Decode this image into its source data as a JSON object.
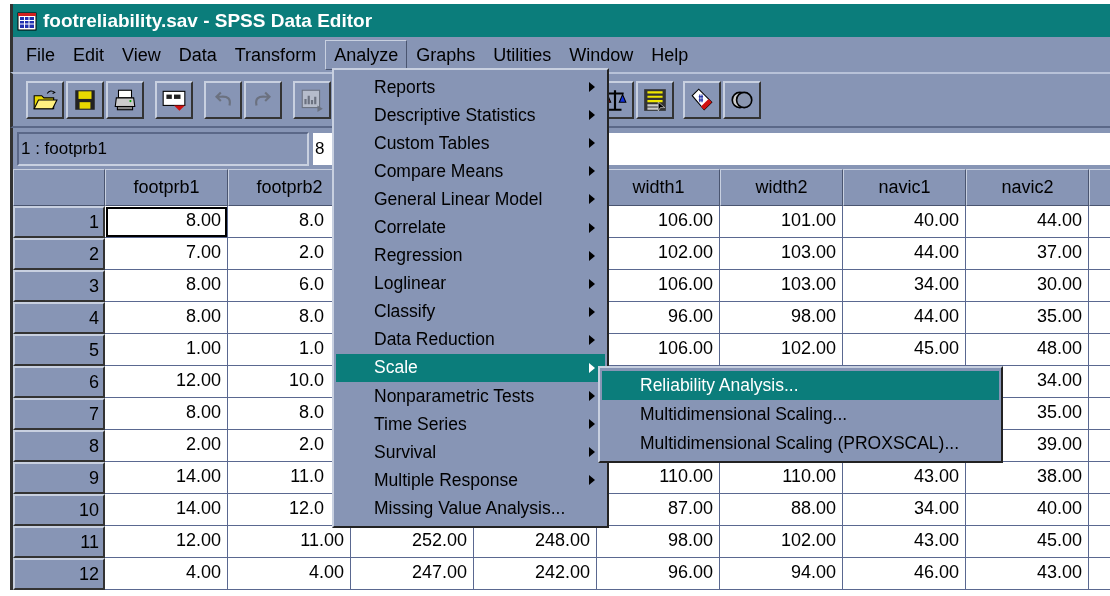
{
  "window": {
    "title": "footreliability.sav - SPSS Data Editor"
  },
  "menu_bar": [
    {
      "label": "File",
      "selected": false
    },
    {
      "label": "Edit",
      "selected": false
    },
    {
      "label": "View",
      "selected": false
    },
    {
      "label": "Data",
      "selected": false
    },
    {
      "label": "Transform",
      "selected": false
    },
    {
      "label": "Analyze",
      "selected": true
    },
    {
      "label": "Graphs",
      "selected": false
    },
    {
      "label": "Utilities",
      "selected": false
    },
    {
      "label": "Window",
      "selected": false
    },
    {
      "label": "Help",
      "selected": false
    }
  ],
  "toolbar": {
    "left": [
      {
        "kind": "open",
        "disabled": false
      },
      {
        "kind": "save",
        "disabled": false
      },
      {
        "kind": "print",
        "disabled": false
      },
      {
        "kind": "dialog",
        "disabled": false
      },
      {
        "kind": "undo",
        "disabled": true
      },
      {
        "kind": "redo",
        "disabled": true
      },
      {
        "kind": "chart",
        "disabled": true
      }
    ],
    "right": [
      {
        "kind": "scales",
        "disabled": false
      },
      {
        "kind": "table",
        "disabled": false
      },
      {
        "kind": "tag",
        "disabled": false
      },
      {
        "kind": "circles",
        "disabled": false
      }
    ]
  },
  "cell_editor": {
    "cell": "1 : footprb1",
    "value": "8"
  },
  "table": {
    "columns": [
      "footprb1",
      "footprb2",
      null,
      null,
      "width1",
      "width2",
      "navic1",
      "navic2"
    ],
    "rows": [
      {
        "label": "1",
        "cells": [
          {
            "value": "8.00",
            "selected": true
          },
          {
            "value": "8.0",
            "selected": false
          },
          null,
          null,
          {
            "value": "106.00",
            "selected": false
          },
          {
            "value": "101.00",
            "selected": false
          },
          {
            "value": "40.00",
            "selected": false
          },
          {
            "value": "44.00",
            "selected": false
          }
        ]
      },
      {
        "label": "2",
        "cells": [
          {
            "value": "7.00",
            "selected": false
          },
          {
            "value": "2.0",
            "selected": false
          },
          null,
          null,
          {
            "value": "102.00",
            "selected": false
          },
          {
            "value": "103.00",
            "selected": false
          },
          {
            "value": "44.00",
            "selected": false
          },
          {
            "value": "37.00",
            "selected": false
          }
        ]
      },
      {
        "label": "3",
        "cells": [
          {
            "value": "8.00",
            "selected": false
          },
          {
            "value": "6.0",
            "selected": false
          },
          null,
          null,
          {
            "value": "106.00",
            "selected": false
          },
          {
            "value": "103.00",
            "selected": false
          },
          {
            "value": "34.00",
            "selected": false
          },
          {
            "value": "30.00",
            "selected": false
          }
        ]
      },
      {
        "label": "4",
        "cells": [
          {
            "value": "8.00",
            "selected": false
          },
          {
            "value": "8.0",
            "selected": false
          },
          null,
          null,
          {
            "value": "96.00",
            "selected": false
          },
          {
            "value": "98.00",
            "selected": false
          },
          {
            "value": "44.00",
            "selected": false
          },
          {
            "value": "35.00",
            "selected": false
          }
        ]
      },
      {
        "label": "5",
        "cells": [
          {
            "value": "1.00",
            "selected": false
          },
          {
            "value": "1.0",
            "selected": false
          },
          null,
          null,
          {
            "value": "106.00",
            "selected": false
          },
          {
            "value": "102.00",
            "selected": false
          },
          {
            "value": "45.00",
            "selected": false
          },
          {
            "value": "48.00",
            "selected": false
          }
        ]
      },
      {
        "label": "6",
        "cells": [
          {
            "value": "12.00",
            "selected": false
          },
          {
            "value": "10.0",
            "selected": false
          },
          null,
          null,
          null,
          null,
          null,
          {
            "value": "34.00",
            "selected": false
          }
        ]
      },
      {
        "label": "7",
        "cells": [
          {
            "value": "8.00",
            "selected": false
          },
          {
            "value": "8.0",
            "selected": false
          },
          null,
          null,
          null,
          null,
          null,
          {
            "value": "35.00",
            "selected": false
          }
        ]
      },
      {
        "label": "8",
        "cells": [
          {
            "value": "2.00",
            "selected": false
          },
          {
            "value": "2.0",
            "selected": false
          },
          null,
          null,
          null,
          null,
          null,
          {
            "value": "39.00",
            "selected": false
          }
        ]
      },
      {
        "label": "9",
        "cells": [
          {
            "value": "14.00",
            "selected": false
          },
          {
            "value": "11.0",
            "selected": false
          },
          null,
          null,
          {
            "value": "110.00",
            "selected": false
          },
          {
            "value": "110.00",
            "selected": false
          },
          {
            "value": "43.00",
            "selected": false
          },
          {
            "value": "38.00",
            "selected": false
          }
        ]
      },
      {
        "label": "10",
        "cells": [
          {
            "value": "14.00",
            "selected": false
          },
          {
            "value": "12.0",
            "selected": false
          },
          null,
          null,
          {
            "value": "87.00",
            "selected": false
          },
          {
            "value": "88.00",
            "selected": false
          },
          {
            "value": "34.00",
            "selected": false
          },
          {
            "value": "40.00",
            "selected": false
          }
        ]
      },
      {
        "label": "11",
        "cells": [
          {
            "value": "12.00",
            "selected": false
          },
          {
            "value": "11.00",
            "selected": false
          },
          {
            "value": "252.00",
            "selected": false
          },
          {
            "value": "248.00",
            "selected": false
          },
          {
            "value": "98.00",
            "selected": false
          },
          {
            "value": "102.00",
            "selected": false
          },
          {
            "value": "43.00",
            "selected": false
          },
          {
            "value": "45.00",
            "selected": false
          }
        ]
      },
      {
        "label": "12",
        "cells": [
          {
            "value": "4.00",
            "selected": false
          },
          {
            "value": "4.00",
            "selected": false
          },
          {
            "value": "247.00",
            "selected": false
          },
          {
            "value": "242.00",
            "selected": false
          },
          {
            "value": "96.00",
            "selected": false
          },
          {
            "value": "94.00",
            "selected": false
          },
          {
            "value": "46.00",
            "selected": false
          },
          {
            "value": "43.00",
            "selected": false
          }
        ]
      }
    ]
  },
  "analyze_menu": [
    {
      "label": "Reports",
      "submenu": true,
      "selected": false
    },
    {
      "label": "Descriptive Statistics",
      "submenu": true,
      "selected": false
    },
    {
      "label": "Custom Tables",
      "submenu": true,
      "selected": false
    },
    {
      "label": "Compare Means",
      "submenu": true,
      "selected": false
    },
    {
      "label": "General Linear Model",
      "submenu": true,
      "selected": false
    },
    {
      "label": "Correlate",
      "submenu": true,
      "selected": false
    },
    {
      "label": "Regression",
      "submenu": true,
      "selected": false
    },
    {
      "label": "Loglinear",
      "submenu": true,
      "selected": false
    },
    {
      "label": "Classify",
      "submenu": true,
      "selected": false
    },
    {
      "label": "Data Reduction",
      "submenu": true,
      "selected": false
    },
    {
      "label": "Scale",
      "submenu": true,
      "selected": true
    },
    {
      "label": "Nonparametric Tests",
      "submenu": true,
      "selected": false
    },
    {
      "label": "Time Series",
      "submenu": true,
      "selected": false
    },
    {
      "label": "Survival",
      "submenu": true,
      "selected": false
    },
    {
      "label": "Multiple Response",
      "submenu": true,
      "selected": false
    },
    {
      "label": "Missing Value Analysis...",
      "submenu": false,
      "selected": false
    }
  ],
  "scale_submenu": [
    {
      "label": "Reliability Analysis...",
      "selected": true
    },
    {
      "label": "Multidimensional Scaling...",
      "selected": false
    },
    {
      "label": "Multidimensional Scaling (PROXSCAL)...",
      "selected": false
    }
  ]
}
